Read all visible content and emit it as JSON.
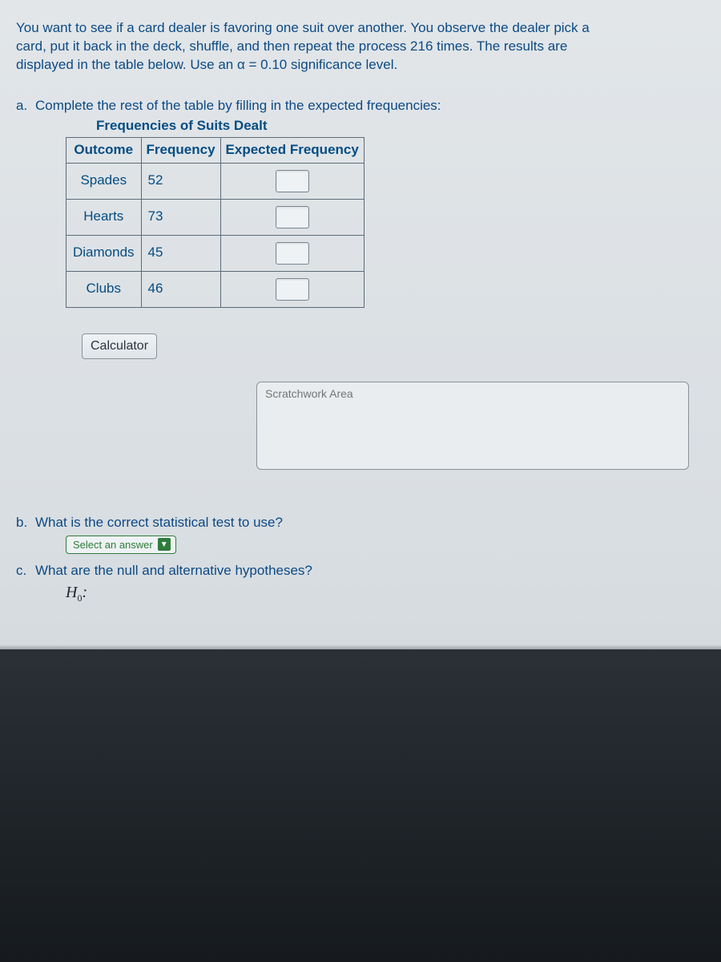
{
  "intro_line1": "You want to see if a card dealer is favoring one suit over another. You observe the dealer pick a",
  "intro_line2": "card, put it back in the deck, shuffle, and then repeat the process 216 times. The results are",
  "intro_line3": "displayed in the table below.  Use an α = 0.10 significance level.",
  "part_a": {
    "letter": "a.",
    "prompt": "Complete the rest of the table by filling in the expected frequencies:",
    "table_title": "Frequencies of Suits Dealt",
    "headers": [
      "Outcome",
      "Frequency",
      "Expected Frequency"
    ],
    "rows": [
      {
        "outcome": "Spades",
        "frequency": "52"
      },
      {
        "outcome": "Hearts",
        "frequency": "73"
      },
      {
        "outcome": "Diamonds",
        "frequency": "45"
      },
      {
        "outcome": "Clubs",
        "frequency": "46"
      }
    ],
    "calculator_label": "Calculator",
    "scratch_placeholder": "Scratchwork Area"
  },
  "part_b": {
    "letter": "b.",
    "prompt": "What is the correct statistical test to use?",
    "select_label": "Select an answer"
  },
  "part_c": {
    "letter": "c.",
    "prompt": "What are the null and alternative hypotheses?",
    "h0_label": "H",
    "h0_sub": "0",
    "h0_colon": ":"
  }
}
